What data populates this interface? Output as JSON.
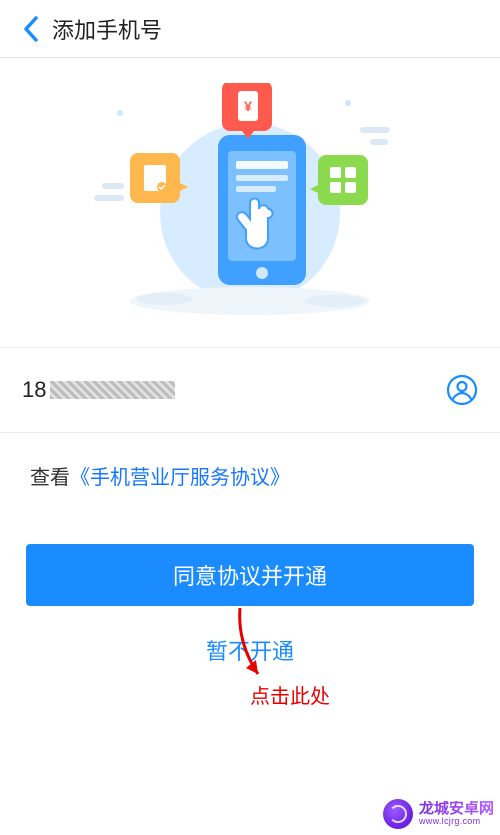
{
  "header": {
    "title": "添加手机号"
  },
  "phone": {
    "visible_prefix": "18"
  },
  "agreement": {
    "prefix": "查看",
    "link_text": "《手机营业厅服务协议》"
  },
  "actions": {
    "primary": "同意协议并开通",
    "secondary": "暂不开通"
  },
  "annotation": {
    "text": "点击此处"
  },
  "watermark": {
    "cn": "龙城安卓网",
    "en": "www.lcjrg.com"
  },
  "colors": {
    "accent": "#1a8cff",
    "link": "#1677ff",
    "annotation": "#e60000",
    "brand": "#7b2fe8"
  }
}
